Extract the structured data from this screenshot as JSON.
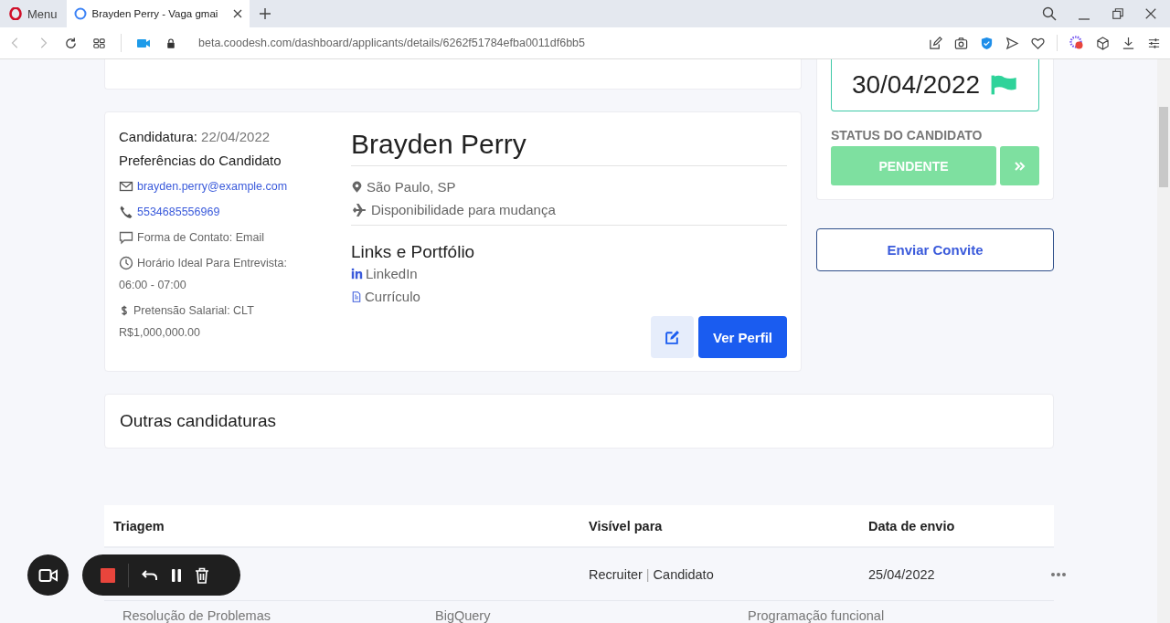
{
  "browser": {
    "menu_label": "Menu",
    "tabs": [
      {
        "title": "Brayden Perry - Vaga gmai",
        "selected": true
      }
    ],
    "url": "beta.coodesh.com/dashboard/applicants/details/6262f51784efba0011df6bb5"
  },
  "candidate": {
    "applied_label": "Candidatura:",
    "applied_date": "22/04/2022",
    "preferences_title": "Preferências do Candidato",
    "contacts": [
      {
        "kind": "email",
        "lines": [
          "brayden.perry@example.com"
        ]
      },
      {
        "kind": "phone",
        "lines": [
          "5534685556969"
        ]
      },
      {
        "kind": "chat",
        "lines": [
          "Forma de Contato: Email"
        ]
      },
      {
        "kind": "clock",
        "lines": [
          "Horário Ideal Para Entrevista:",
          "06:00 - 07:00"
        ]
      },
      {
        "kind": "money",
        "lines": [
          "Pretensão Salarial: CLT",
          "R$1,000,000.00"
        ]
      }
    ],
    "name": "Brayden Perry",
    "location": "São Paulo, SP",
    "mobility": "Disponibilidade para mudança",
    "links_title": "Links e Portfólio",
    "links": [
      {
        "kind": "linkedin",
        "label": "LinkedIn"
      },
      {
        "kind": "document",
        "label": "Currículo"
      }
    ],
    "view_button": "Ver Perfil"
  },
  "sidebar": {
    "deadline": "30/04/2022",
    "status_label": "STATUS DO CANDIDATO",
    "status": "PENDENTE",
    "invite_button": "Enviar Convite"
  },
  "other_applications": {
    "title": "Outras candidaturas"
  },
  "table": {
    "columns": [
      "Triagem",
      "Visível para",
      "Data de envio"
    ],
    "rows": [
      {
        "visible_to": [
          "Recruiter",
          "Candidato"
        ],
        "separator": "|",
        "date": "25/04/2022"
      }
    ],
    "tags": [
      "Resolução de Problemas",
      "BigQuery",
      "Programação funcional"
    ]
  }
}
